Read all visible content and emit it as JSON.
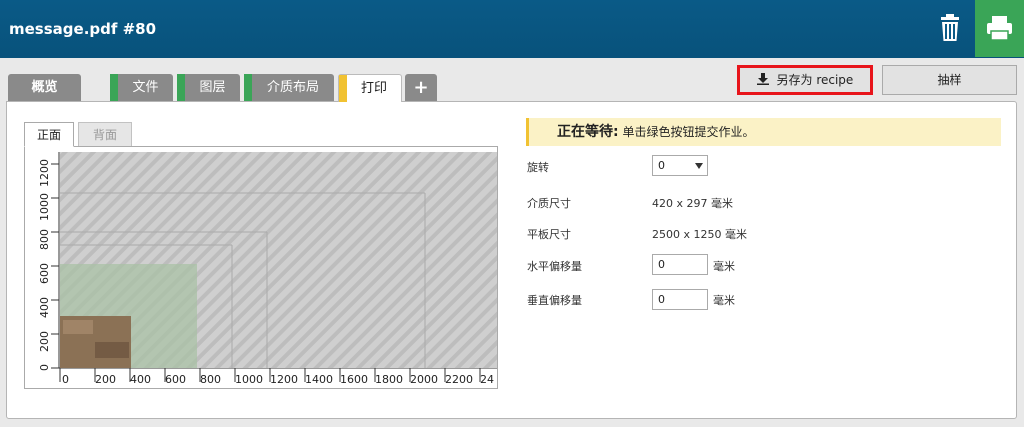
{
  "header": {
    "title": "message.pdf #80"
  },
  "tabs": [
    {
      "label": "概览"
    },
    {
      "label": "文件"
    },
    {
      "label": "图层"
    },
    {
      "label": "介质布局"
    },
    {
      "label": "打印"
    },
    {
      "label": "+"
    }
  ],
  "actions": {
    "save_recipe": "另存为 recipe",
    "sample": "抽样"
  },
  "preview": {
    "tab_front": "正面",
    "tab_back": "背面",
    "x_ticks": [
      "0",
      "200",
      "400",
      "600",
      "800",
      "1000",
      "1200",
      "1400",
      "1600",
      "1800",
      "2000",
      "2200",
      "24"
    ],
    "y_ticks": [
      "0",
      "200",
      "400",
      "600",
      "800",
      "1000",
      "1200"
    ]
  },
  "status": {
    "title": "正在等待:",
    "message": "单击绿色按钮提交作业。"
  },
  "form": {
    "rotation_label": "旋转",
    "rotation_value": "0",
    "media_size_label": "介质尺寸",
    "media_size_value": "420 x 297 毫米",
    "bed_size_label": "平板尺寸",
    "bed_size_value": "2500 x 1250 毫米",
    "h_offset_label": "水平偏移量",
    "h_offset_value": "0",
    "v_offset_label": "垂直偏移量",
    "v_offset_value": "0",
    "unit": "毫米"
  },
  "colors": {
    "header": "#0a5a87",
    "green": "#3aa557",
    "yellow": "#f1c232"
  }
}
